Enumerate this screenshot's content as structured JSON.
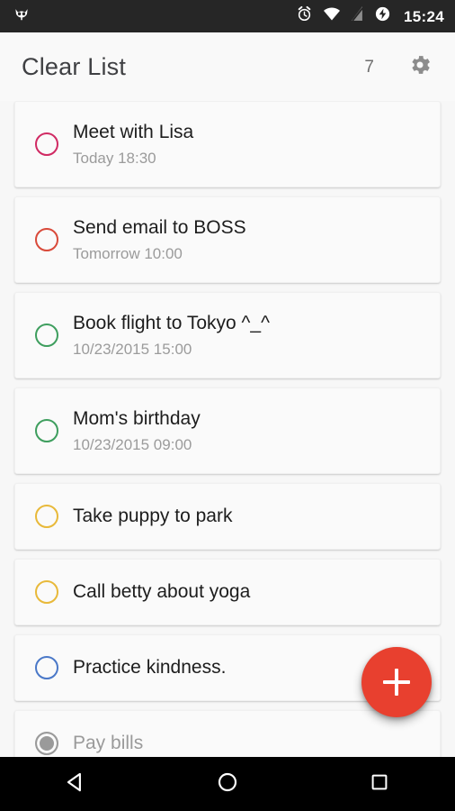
{
  "statusbar": {
    "left_icon": "cyanogenmod-cid-icon",
    "icons": [
      "alarm-icon",
      "wifi-icon",
      "signal-icon",
      "charging-battery-icon"
    ],
    "clock": "15:24"
  },
  "header": {
    "title": "Clear List",
    "count": "7",
    "settings_icon": "gear-icon"
  },
  "tasks": [
    {
      "title": "Meet with Lisa",
      "subtitle": "Today 18:30",
      "color": "#d02a63",
      "done": false
    },
    {
      "title": "Send email to BOSS",
      "subtitle": "Tomorrow 10:00",
      "color": "#d94a3a",
      "done": false
    },
    {
      "title": "Book flight to Tokyo ^_^",
      "subtitle": "10/23/2015 15:00",
      "color": "#3e9e5e",
      "done": false
    },
    {
      "title": "Mom's birthday",
      "subtitle": "10/23/2015 09:00",
      "color": "#3e9e5e",
      "done": false
    },
    {
      "title": "Take puppy to park",
      "subtitle": "",
      "color": "#e8b93a",
      "done": false
    },
    {
      "title": "Call betty about yoga",
      "subtitle": "",
      "color": "#e8b93a",
      "done": false
    },
    {
      "title": "Practice kindness.",
      "subtitle": "",
      "color": "#4a78c8",
      "done": false
    },
    {
      "title": "Pay bills",
      "subtitle": "",
      "color": "#9a9a9a",
      "done": true
    }
  ],
  "fab": {
    "icon": "plus-icon",
    "color": "#e8402f",
    "label": "Add task"
  },
  "navbar": {
    "back": "back-triangle-icon",
    "home": "home-circle-icon",
    "recents": "recents-square-icon"
  },
  "colors": {
    "accent": "#e8402f",
    "page_background": "#f7f7f7",
    "card_background": "#fafafa",
    "statusbar_background": "#262626",
    "navbar_background": "#000000"
  }
}
